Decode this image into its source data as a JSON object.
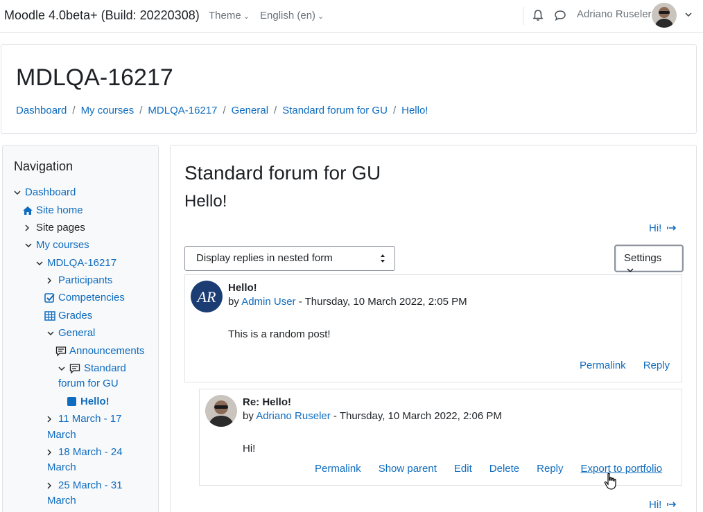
{
  "navbar": {
    "brand": "Moodle 4.0beta+ (Build: 20220308)",
    "theme_label": "Theme",
    "language_label": "English (en)",
    "username": "Adriano Ruseler"
  },
  "header": {
    "title": "MDLQA-16217",
    "breadcrumb": [
      "Dashboard",
      "My courses",
      "MDLQA-16217",
      "General",
      "Standard forum for GU",
      "Hello!"
    ],
    "breadcrumb_sep": "/"
  },
  "navigation": {
    "title": "Navigation",
    "items": [
      {
        "label": "Dashboard"
      },
      {
        "label": "Site home"
      },
      {
        "label": "Site pages"
      },
      {
        "label": "My courses"
      },
      {
        "label": "MDLQA-16217"
      },
      {
        "label": "Participants"
      },
      {
        "label": "Competencies"
      },
      {
        "label": "Grades"
      },
      {
        "label": "General"
      },
      {
        "label": "Announcements"
      },
      {
        "label_line1": "Standard",
        "label_line2": "forum for GU"
      },
      {
        "label": "Hello!"
      },
      {
        "label_line1": "11 March - 17",
        "label_line2": "March"
      },
      {
        "label_line1": "18 March - 24",
        "label_line2": "March"
      },
      {
        "label_line1": "25 March - 31",
        "label_line2": "March"
      }
    ]
  },
  "main": {
    "forum_title": "Standard forum for GU",
    "discussion_title": "Hello!",
    "next_link_top": "Hi!",
    "next_link_bottom": "Hi!",
    "display_mode": "Display replies in nested form",
    "settings_label": "Settings",
    "posts": [
      {
        "subject": "Hello!",
        "by": "by",
        "author": "Admin User",
        "date": "- Thursday, 10 March 2022, 2:05 PM",
        "content": "This is a random post!",
        "actions": [
          "Permalink",
          "Reply"
        ]
      },
      {
        "subject": "Re: Hello!",
        "by": "by",
        "author": "Adriano Ruseler",
        "date": "- Thursday, 10 March 2022, 2:06 PM",
        "content": "Hi!",
        "actions": [
          "Permalink",
          "Show parent",
          "Edit",
          "Delete",
          "Reply",
          "Export to portfolio"
        ]
      }
    ]
  },
  "colors": {
    "link": "#0f6cbf",
    "text": "#1d2125",
    "muted": "#6a737b",
    "border": "#dee2e6"
  }
}
